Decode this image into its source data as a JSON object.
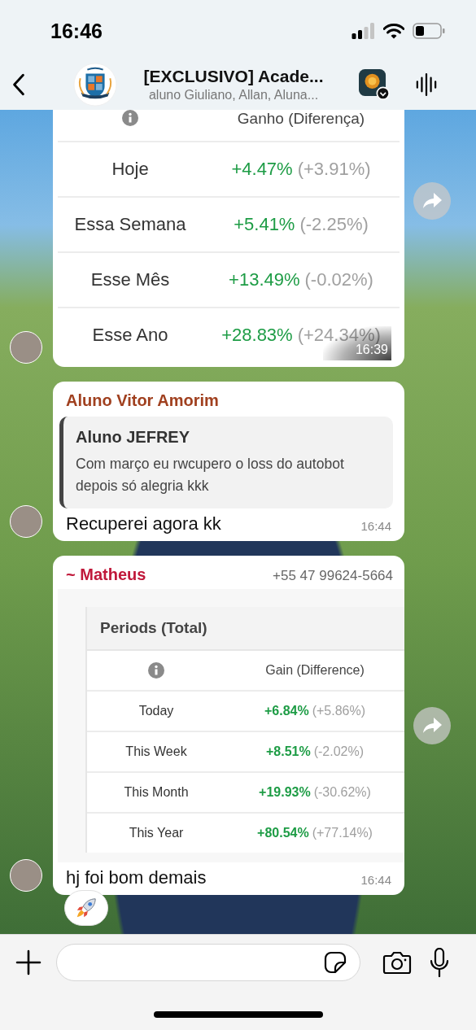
{
  "status_bar": {
    "time": "16:46"
  },
  "header": {
    "title": "[EXCLUSIVO] Acade...",
    "subtitle": "aluno Giuliano, Allan, Aluna..."
  },
  "messages": [
    {
      "kind": "table_image",
      "forward": true,
      "time": "16:39",
      "table": {
        "column_header": "Ganho (Diferença)",
        "rows": [
          {
            "period": "Hoje",
            "gain": "+4.47%",
            "difference": "(+3.91%)"
          },
          {
            "period": "Essa Semana",
            "gain": "+5.41%",
            "difference": "(-2.25%)"
          },
          {
            "period": "Esse Mês",
            "gain": "+13.49%",
            "difference": "(-0.02%)"
          },
          {
            "period": "Esse Ano",
            "gain": "+28.83%",
            "difference": "(+24.34%)"
          }
        ]
      }
    },
    {
      "kind": "reply",
      "sender": "Aluno Vitor Amorim",
      "color": "#a0401f",
      "quote": {
        "author": "Aluno JEFREY",
        "text": "Com março eu rwcupero o loss do autobot depois só alegria kkk"
      },
      "text": "Recuperei agora kk",
      "time": "16:44"
    },
    {
      "kind": "table_image",
      "forward": true,
      "sender": "~ Matheus",
      "color": "#c0183a",
      "phone": "+55 47 99624-5664",
      "text": "hj foi bom demais",
      "time": "16:44",
      "reaction": {
        "kind": "rocket"
      },
      "table": {
        "title": "Periods (Total)",
        "column_header": "Gain (Difference)",
        "rows": [
          {
            "period": "Today",
            "gain": "+6.84%",
            "difference": "(+5.86%)"
          },
          {
            "period": "This Week",
            "gain": "+8.51%",
            "difference": "(-2.02%)"
          },
          {
            "period": "This Month",
            "gain": "+19.93%",
            "difference": "(-30.62%)"
          },
          {
            "period": "This Year",
            "gain": "+80.54%",
            "difference": "(+77.14%)"
          }
        ]
      }
    }
  ]
}
